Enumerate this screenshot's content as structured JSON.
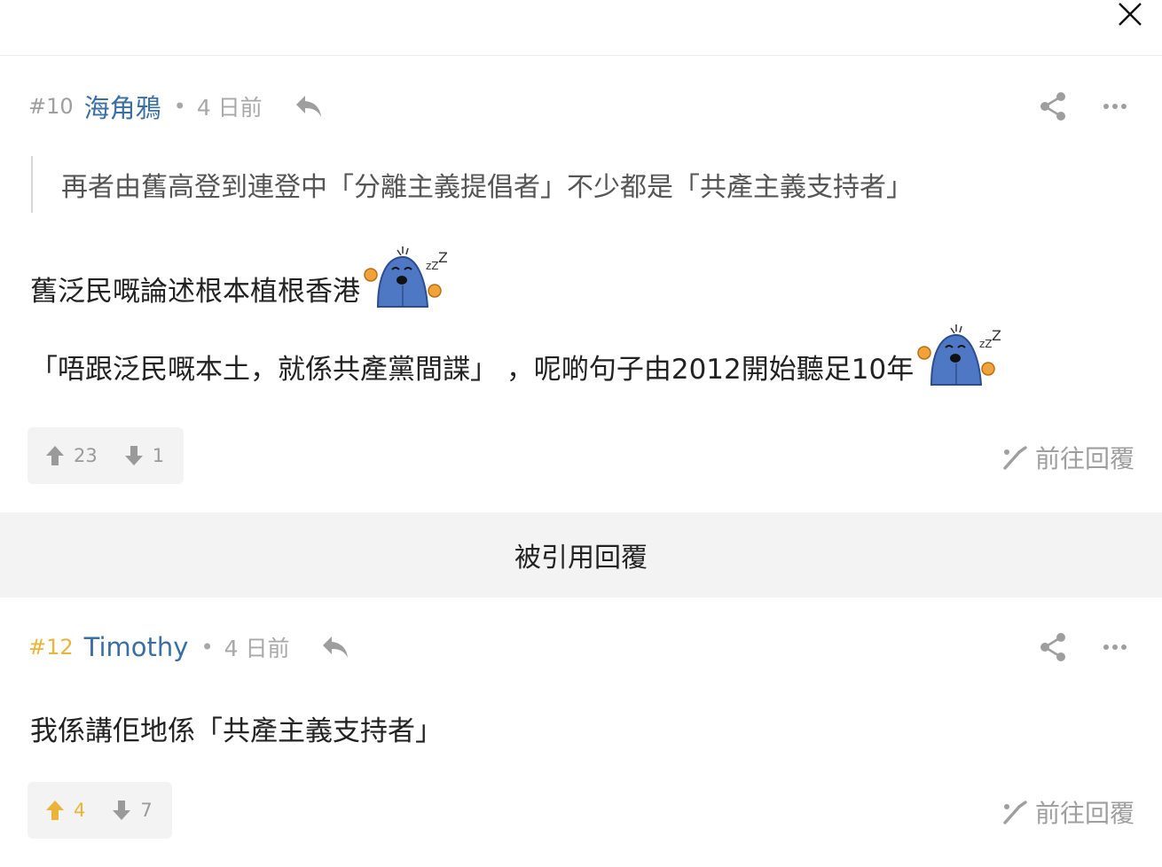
{
  "close": {
    "icon": "close-icon"
  },
  "posts": [
    {
      "floor": "#10",
      "username": "海角鴉",
      "separator": "•",
      "time": "4 日前",
      "quote": "再者由舊高登到連登中「分離主義提倡者」不少都是「共產主義支持者」",
      "lines": [
        "舊泛民嘅論述根本植根香港",
        "「唔跟泛民嘅本土，就係共產黨間諜」 ，呢啲句子由2012開始聽足10年"
      ],
      "upvotes": "23",
      "downvotes": "1",
      "goto_reply_label": "前往回覆"
    },
    {
      "floor": "#12",
      "username": "Timothy",
      "separator": "•",
      "time": "4 日前",
      "lines": [
        "我係講佢地係「共產主義支持者」"
      ],
      "upvotes": "4",
      "downvotes": "7",
      "goto_reply_label": "前往回覆"
    }
  ],
  "section_title": "被引用回覆",
  "colors": {
    "username": "#3a6fa3",
    "highlight": "#e9b43a",
    "muted": "#9e9e9e",
    "section_bg": "#f3f3f3"
  }
}
